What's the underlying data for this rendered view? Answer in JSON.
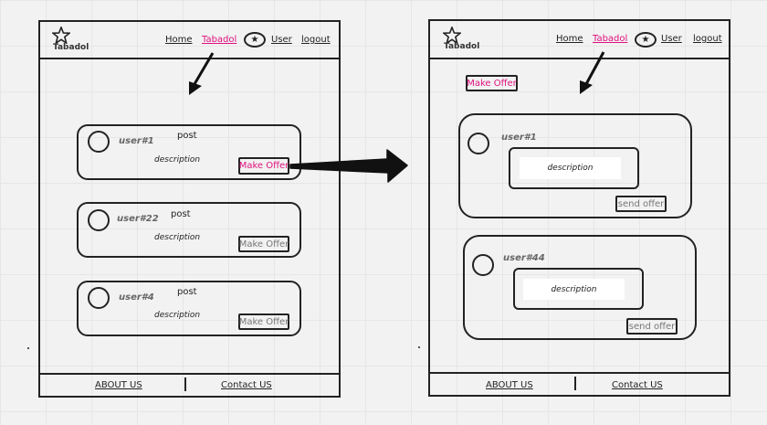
{
  "brand": {
    "name": "Tabadol",
    "logo_icon": "star-outline-icon"
  },
  "nav": {
    "home": "Home",
    "tabadol": "Tabadol",
    "star_icon": "star-icon",
    "user": "User",
    "logout": "logout"
  },
  "left_screen": {
    "posts": [
      {
        "user": "user#1",
        "post": "post",
        "description": "description",
        "button": "Make Offer"
      },
      {
        "user": "user#22",
        "post": "post",
        "description": "description",
        "button": "Make Offer"
      },
      {
        "user": "user#4",
        "post": "post",
        "description": "description",
        "button": "Make Offer"
      }
    ]
  },
  "right_screen": {
    "make_offer_label": "Make Offer",
    "offers": [
      {
        "user": "user#1",
        "description": "description",
        "button": "send offer"
      },
      {
        "user": "user#44",
        "description": "description",
        "button": "send offer"
      }
    ]
  },
  "footer": {
    "about": "ABOUT US",
    "contact": "Contact US"
  },
  "colors": {
    "accent": "#e0117f",
    "line": "#222222",
    "background": "#f2f2f2"
  }
}
